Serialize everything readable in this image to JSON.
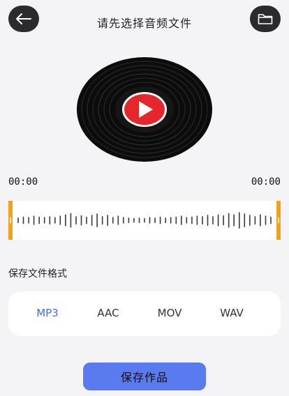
{
  "header": {
    "title": "请先选择音频文件"
  },
  "times": {
    "start": "00:00",
    "end": "00:00"
  },
  "waveform": {
    "bar_levels": [
      0.25,
      0.35,
      0.3,
      0.45,
      0.35,
      0.3,
      0.4,
      0.3,
      0.45,
      0.6,
      0.75,
      0.4,
      0.5,
      0.35,
      0.55,
      0.7,
      0.4,
      0.55,
      0.3,
      0.45,
      0.3,
      0.25,
      0.2,
      0.25,
      0.2,
      0.3,
      0.25,
      0.35,
      0.25,
      0.3,
      0.35,
      0.45,
      0.3,
      0.35,
      0.45,
      0.4,
      0.55,
      0.4,
      0.6,
      0.5,
      0.75,
      0.6,
      0.85,
      0.7,
      0.55,
      0.4,
      0.6,
      0.45,
      0.35
    ],
    "handle_color": "#f0a21c"
  },
  "format": {
    "label": "保存文件格式",
    "options": [
      "MP3",
      "AAC",
      "MOV",
      "WAV"
    ],
    "selected": "MP3",
    "accent_color": "#3d6ef5"
  },
  "actions": {
    "save_label": "保存作品",
    "button_color": "#5a7bf0"
  },
  "icons": {
    "back": "arrow-left-icon",
    "folder": "folder-icon",
    "play": "play-icon"
  }
}
